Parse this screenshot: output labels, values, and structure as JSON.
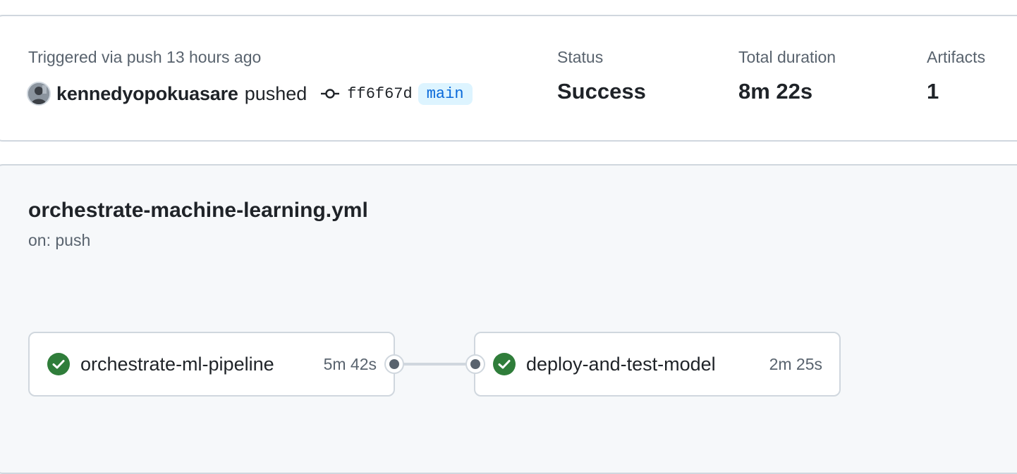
{
  "summary": {
    "trigger_text": "Triggered via push 13 hours ago",
    "actor": "kennedyopokuasare",
    "action": "pushed",
    "commit_sha": "ff6f67d",
    "branch": "main",
    "status_label": "Status",
    "status_value": "Success",
    "duration_label": "Total duration",
    "duration_value": "8m 22s",
    "artifacts_label": "Artifacts",
    "artifacts_value": "1"
  },
  "workflow": {
    "file_name": "orchestrate-machine-learning.yml",
    "trigger": "on: push",
    "jobs": [
      {
        "name": "orchestrate-ml-pipeline",
        "duration": "5m 42s",
        "status": "success"
      },
      {
        "name": "deploy-and-test-model",
        "duration": "2m 25s",
        "status": "success"
      }
    ]
  },
  "colors": {
    "success": "#2f7d3a",
    "accent": "#0969da",
    "muted_text": "#59636e",
    "border": "#d0d7de"
  },
  "icons": {
    "commit": "git-commit-icon",
    "success": "check-circle-fill-icon"
  }
}
